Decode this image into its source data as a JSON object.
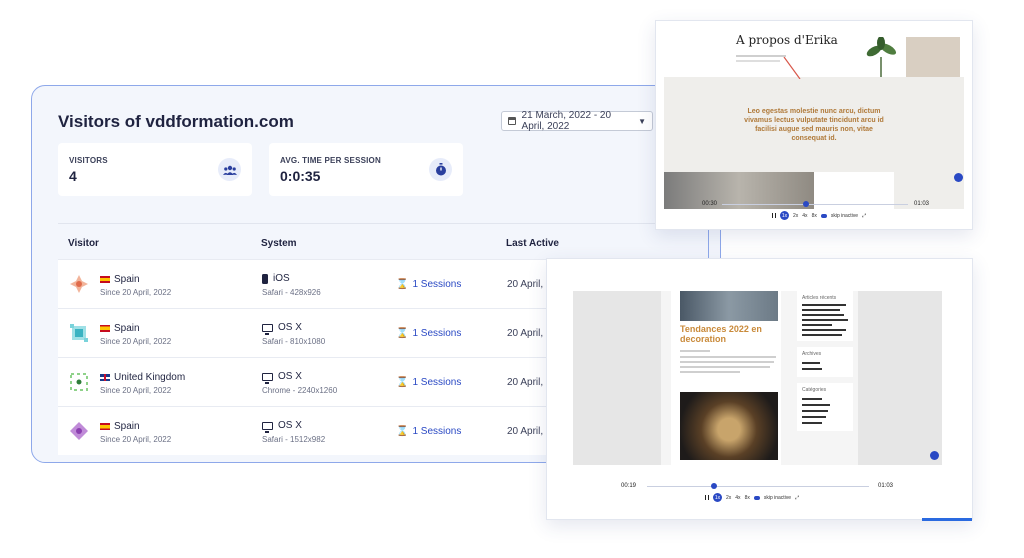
{
  "dashboard": {
    "title": "Visitors of vddformation.com",
    "date_range": "21 March, 2022 - 20 April, 2022",
    "stats": [
      {
        "label": "VISITORS",
        "value": "4",
        "icon": "users-icon"
      },
      {
        "label": "AVG. TIME PER SESSION",
        "value": "0:0:35",
        "icon": "stopwatch-icon"
      }
    ],
    "columns": [
      "Visitor",
      "System",
      "Last Active"
    ],
    "rows": [
      {
        "country": "Spain",
        "since": "Since 20 April, 2022",
        "system": "iOS",
        "system_detail": "Safari - 428x926",
        "sessions": "1 Sessions",
        "last_active": "20 April, 2"
      },
      {
        "country": "Spain",
        "since": "Since 20 April, 2022",
        "system": "OS X",
        "system_detail": "Safari - 810x1080",
        "sessions": "1 Sessions",
        "last_active": "20 April, 2"
      },
      {
        "country": "United Kingdom",
        "since": "Since 20 April, 2022",
        "system": "OS X",
        "system_detail": "Chrome - 2240x1260",
        "sessions": "1 Sessions",
        "last_active": "20 April, 2"
      },
      {
        "country": "Spain",
        "since": "Since 20 April, 2022",
        "system": "OS X",
        "system_detail": "Safari - 1512x982",
        "sessions": "1 Sessions",
        "last_active": "20 April, 2"
      }
    ]
  },
  "replay1": {
    "page_title": "A propos d'Erika",
    "quote": "Leo egestas molestie nunc arcu, dictum vivamus lectus vulputate tincidunt arcu id facilisi augue sed mauris non, vitae consequat id.",
    "time_current": "00:30",
    "time_total": "01:03",
    "progress": 0.45,
    "speeds": [
      "1x",
      "2x",
      "4x",
      "8x"
    ],
    "selected_speed": "1x",
    "skip_label": "skip inactive"
  },
  "replay2": {
    "article_title": "Tendances 2022 en decoration",
    "sidebar_headings": [
      "Articles récents",
      "Archives",
      "Catégories"
    ],
    "time_current": "00:19",
    "time_total": "01:03",
    "progress": 0.3,
    "speeds": [
      "1x",
      "2x",
      "4x",
      "8x"
    ],
    "selected_speed": "1x",
    "skip_label": "skip inactive"
  },
  "colors": {
    "accent": "#2a49c4",
    "card_border": "#8ea8ea",
    "heading_gold": "#b07a3a"
  }
}
